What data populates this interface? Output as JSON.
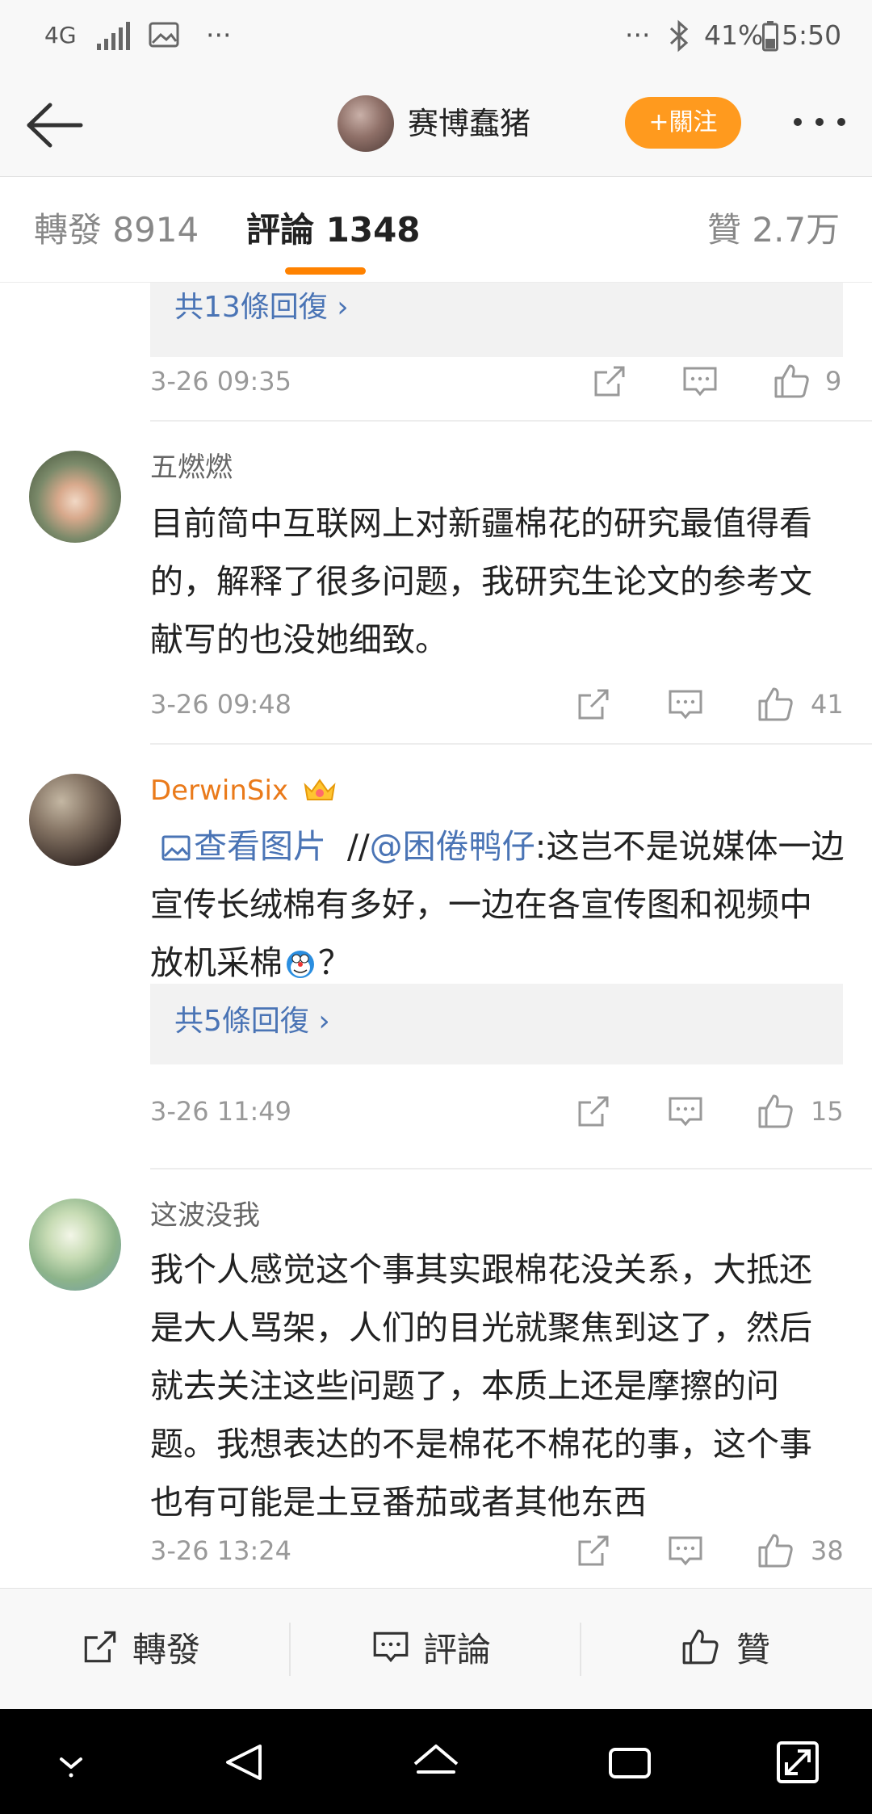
{
  "status_bar": {
    "network": "4G",
    "more": "···",
    "right_more": "···",
    "battery": "41%",
    "time": "5:50"
  },
  "header": {
    "user_name": "赛博蠢猪",
    "follow_label": "+關注"
  },
  "tabs": [
    {
      "label": "轉發 8914"
    },
    {
      "label": "評論 1348"
    },
    {
      "label": "贊 2.7万"
    }
  ],
  "feed": {
    "top_reply_label": "共13條回復 ›",
    "top_time": "3-26 09:35",
    "top_likes": "9",
    "comments": [
      {
        "name": "五燃燃",
        "body": "目前简中互联网上对新疆棉花的研究最值得看的，解释了很多问题，我研究生论文的参考文献写的也没她细致。",
        "time": "3-26 09:48",
        "likes": "41"
      },
      {
        "name": "DerwinSix",
        "body_link_image": "查看图片",
        "body_slashes": "//",
        "body_mention": "@困倦鸭仔",
        "body_text": ":这岂不是说媒体一边宣传长绒棉有多好，一边在各宣传图和视频中放机采棉",
        "body_end": "？",
        "reply_label": "共5條回復 ›",
        "time": "3-26 11:49",
        "likes": "15"
      },
      {
        "name": "这波没我",
        "body": "我个人感觉这个事其实跟棉花没关系，大抵还是大人骂架，人们的目光就聚焦到这了，然后就去关注这些问题了，本质上还是摩擦的问题。我想表达的不是棉花不棉花的事，这个事也有可能是土豆番茄或者其他东西",
        "time": "3-26 13:24",
        "likes": "38"
      }
    ]
  },
  "bottom_bar": {
    "repost": "轉發",
    "comment": "評論",
    "like": "贊"
  },
  "colors": {
    "accent": "#ff8200",
    "link": "#4a74b5",
    "follow": "#ff9a1e"
  }
}
